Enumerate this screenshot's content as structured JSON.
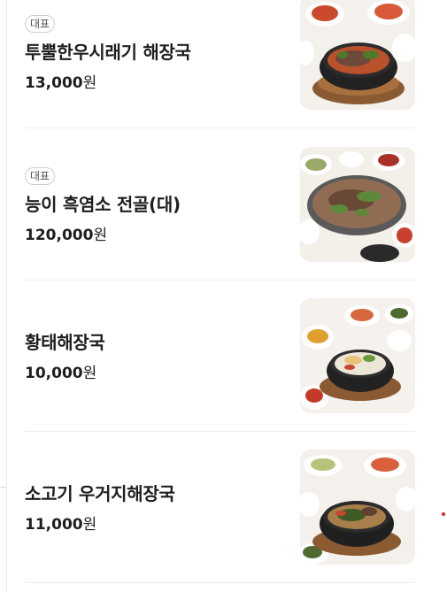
{
  "menu": {
    "items": [
      {
        "badge": "대표",
        "name": "투뿔한우시래기 해장국",
        "price": "13,000",
        "currency": "원",
        "image": "soup-with-sides-photo"
      },
      {
        "badge": "대표",
        "name": "능이 흑염소 전골(대)",
        "price": "120,000",
        "currency": "원",
        "image": "hotpot-photo"
      },
      {
        "badge": "",
        "name": "황태해장국",
        "price": "10,000",
        "currency": "원",
        "image": "pollack-soup-photo"
      },
      {
        "badge": "",
        "name": "소고기 우거지해장국",
        "price": "11,000",
        "currency": "원",
        "image": "beef-soup-photo"
      }
    ]
  },
  "colors": {
    "accent_dot": "#e0282e",
    "divider": "#eeeeee",
    "text": "#1e1e1e"
  }
}
